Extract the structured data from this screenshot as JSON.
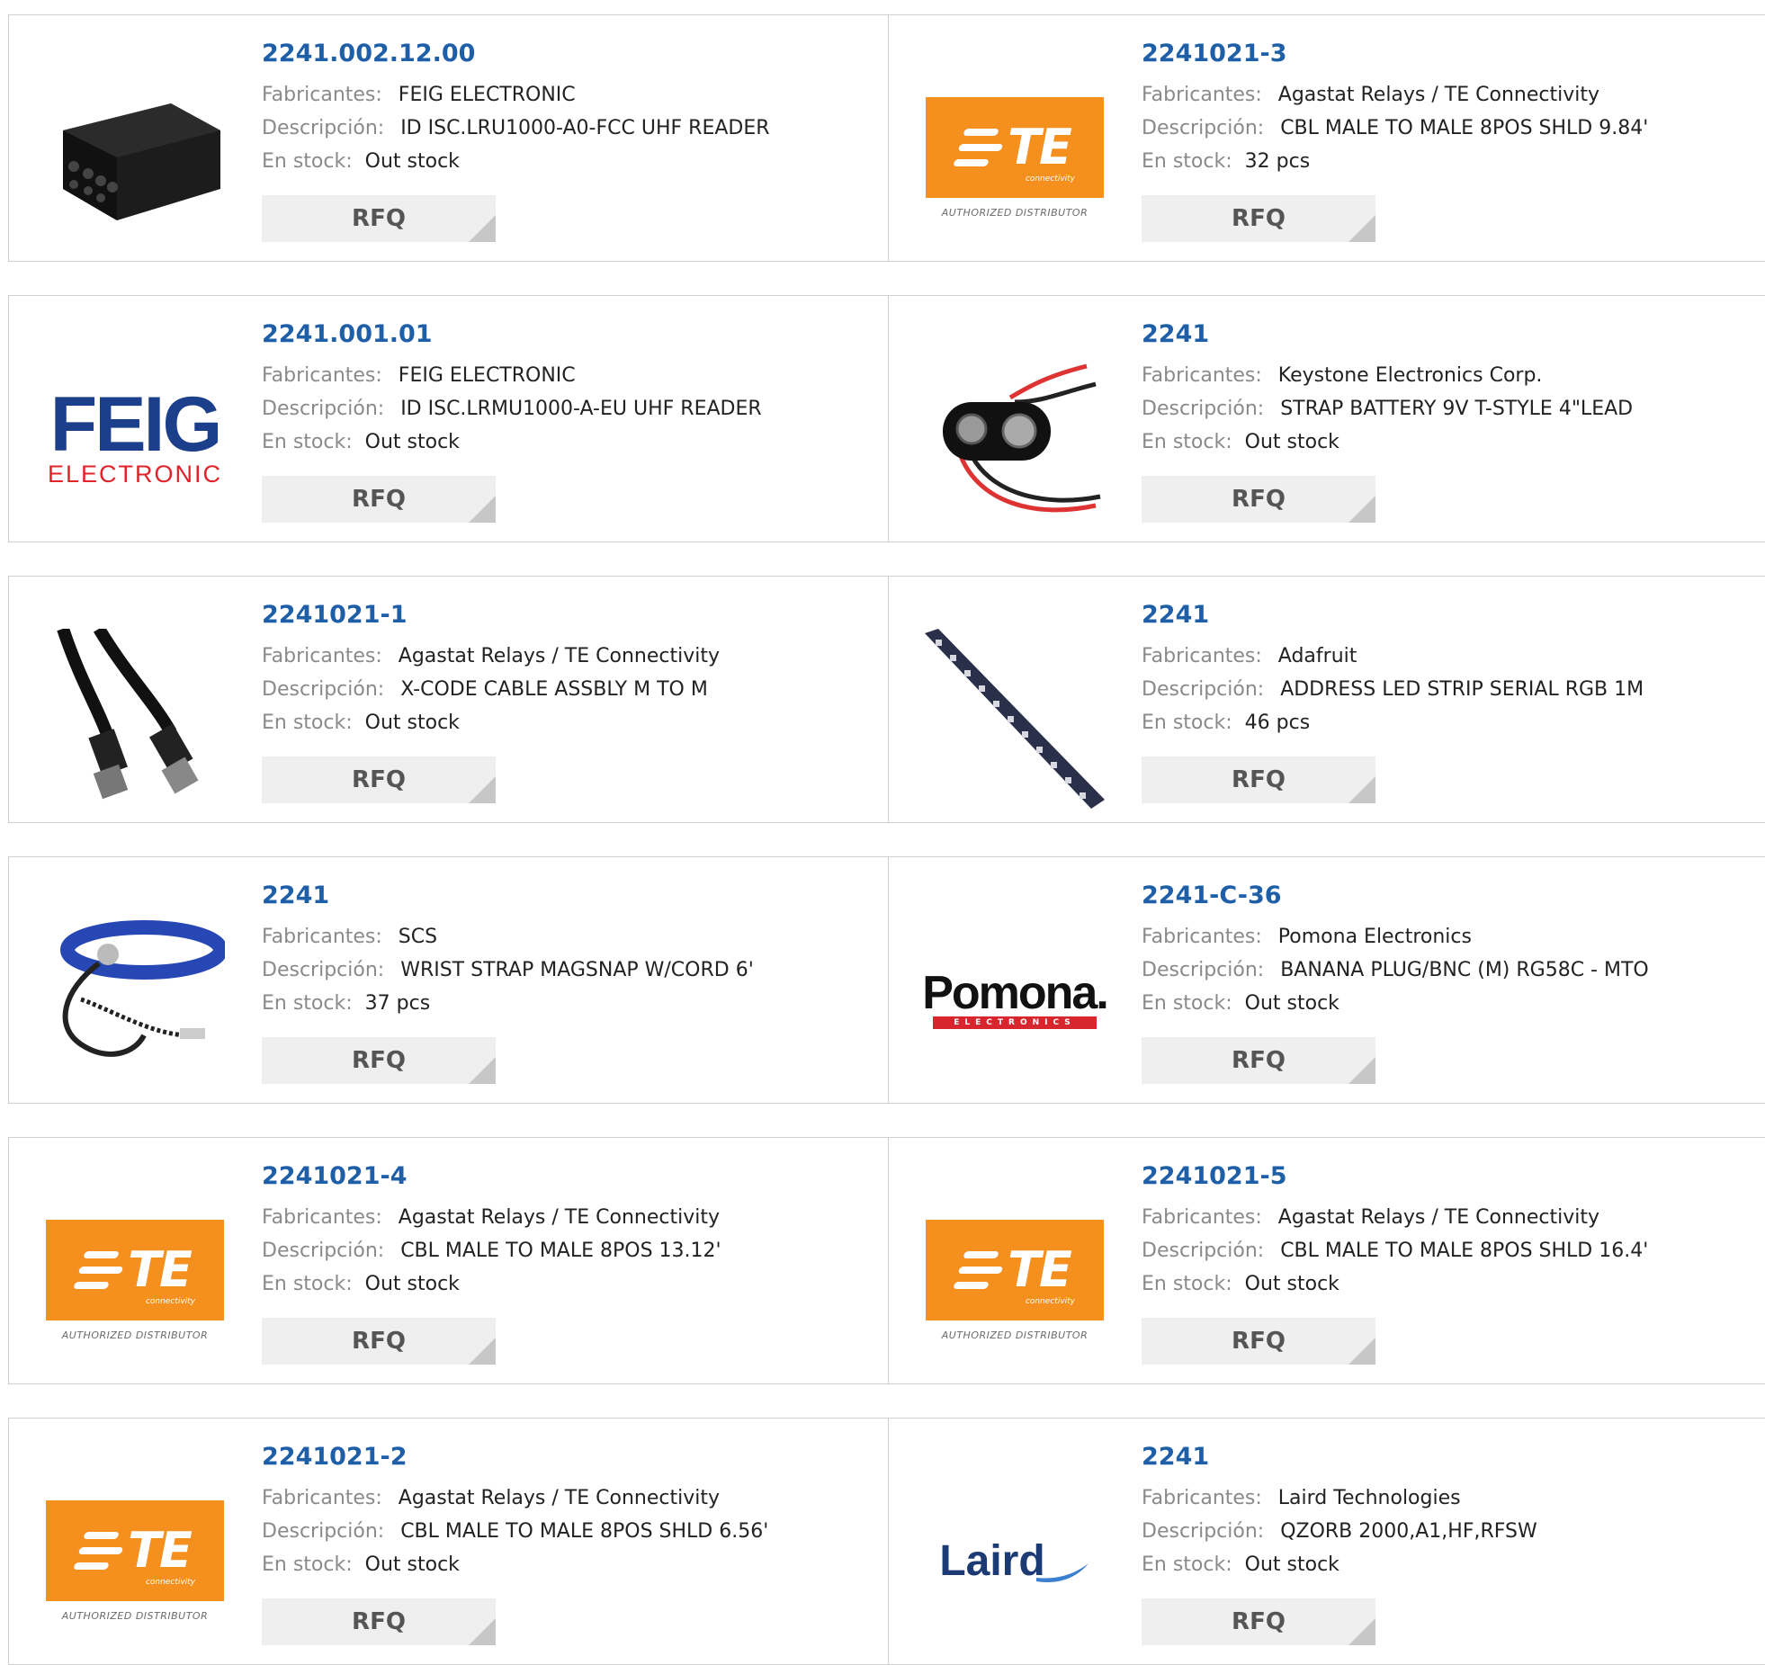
{
  "labels": {
    "manufacturer": "Fabricantes:",
    "description": "Descripción:",
    "stock": "En stock:",
    "rfq": "RFQ"
  },
  "colors": {
    "part_link": "#1f5fa8",
    "te_orange": "#f5901e",
    "feig_blue": "#1b3f8a",
    "feig_red": "#e0242a",
    "pomona_red": "#d7262e"
  },
  "logos": {
    "te": {
      "mark": "TE",
      "sub": "connectivity",
      "tagline": "AUTHORIZED DISTRIBUTOR"
    },
    "feig": {
      "big": "FEIG",
      "small": "ELECTRONIC"
    },
    "pomona": {
      "big": "Pomona.",
      "small": "ELECTRONICS"
    },
    "laird": {
      "text": "Laird"
    }
  },
  "products": [
    {
      "part": "2241.002.12.00",
      "manufacturer": "FEIG ELECTRONIC",
      "description": "ID ISC.LRU1000-A0-FCC UHF READER",
      "stock": "Out stock",
      "image": "black-reader-box-icon"
    },
    {
      "part": "2241021-3",
      "manufacturer": "Agastat Relays / TE Connectivity",
      "description": "CBL MALE TO MALE 8POS SHLD 9.84'",
      "stock": "32 pcs",
      "image": "te-logo"
    },
    {
      "part": "2241.001.01",
      "manufacturer": "FEIG ELECTRONIC",
      "description": "ID ISC.LRMU1000-A-EU UHF READER",
      "stock": "Out stock",
      "image": "feig-logo"
    },
    {
      "part": "2241",
      "manufacturer": "Keystone Electronics Corp.",
      "description": "STRAP BATTERY 9V T-STYLE 4\"LEAD",
      "stock": "Out stock",
      "image": "battery-strap-icon"
    },
    {
      "part": "2241021-1",
      "manufacturer": "Agastat Relays / TE Connectivity",
      "description": "X-CODE CABLE ASSBLY M TO M",
      "stock": "Out stock",
      "image": "cable-connectors-icon"
    },
    {
      "part": "2241",
      "manufacturer": "Adafruit",
      "description": "ADDRESS LED STRIP SERIAL RGB 1M",
      "stock": "46 pcs",
      "image": "led-strip-icon"
    },
    {
      "part": "2241",
      "manufacturer": "SCS",
      "description": "WRIST STRAP MAGSNAP W/CORD 6'",
      "stock": "37 pcs",
      "image": "wrist-strap-icon"
    },
    {
      "part": "2241-C-36",
      "manufacturer": "Pomona Electronics",
      "description": "BANANA PLUG/BNC (M) RG58C - MTO",
      "stock": "Out stock",
      "image": "pomona-logo"
    },
    {
      "part": "2241021-4",
      "manufacturer": "Agastat Relays / TE Connectivity",
      "description": "CBL MALE TO MALE 8POS 13.12'",
      "stock": "Out stock",
      "image": "te-logo"
    },
    {
      "part": "2241021-5",
      "manufacturer": "Agastat Relays / TE Connectivity",
      "description": "CBL MALE TO MALE 8POS SHLD 16.4'",
      "stock": "Out stock",
      "image": "te-logo"
    },
    {
      "part": "2241021-2",
      "manufacturer": "Agastat Relays / TE Connectivity",
      "description": "CBL MALE TO MALE 8POS SHLD 6.56'",
      "stock": "Out stock",
      "image": "te-logo"
    },
    {
      "part": "2241",
      "manufacturer": "Laird Technologies",
      "description": "QZORB 2000,A1,HF,RFSW",
      "stock": "Out stock",
      "image": "laird-logo"
    }
  ]
}
